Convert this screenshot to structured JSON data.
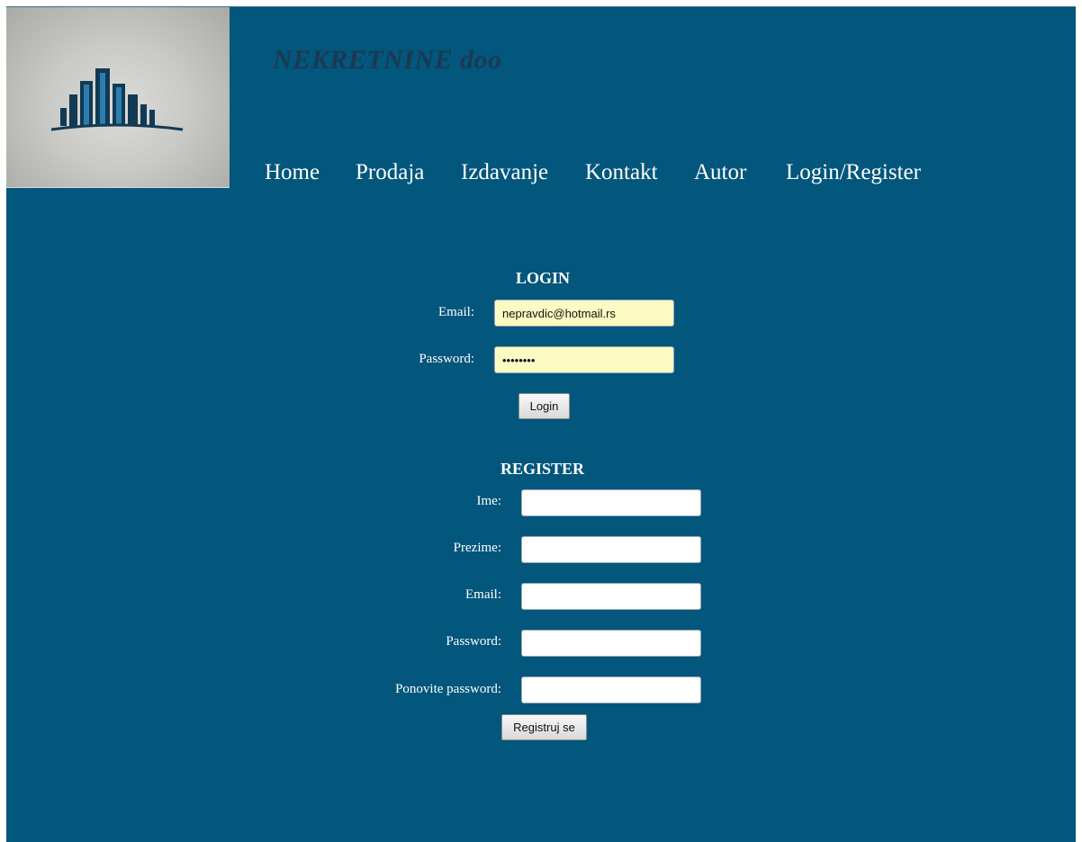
{
  "brand": {
    "name": "NEKRETNINE doo"
  },
  "nav": {
    "items": [
      {
        "label": "Home"
      },
      {
        "label": "Prodaja"
      },
      {
        "label": "Izdavanje"
      },
      {
        "label": "Kontakt"
      },
      {
        "label": "Autor"
      },
      {
        "label": "Login/Register"
      }
    ]
  },
  "login": {
    "title": "LOGIN",
    "email_label": "Email:",
    "email_value": "nepravdic@hotmail.rs",
    "password_label": "Password:",
    "password_value": "passwor1",
    "submit_label": "Login"
  },
  "register": {
    "title": "REGISTER",
    "ime_label": "Ime:",
    "prezime_label": "Prezime:",
    "email_label": "Email:",
    "password_label": "Password:",
    "repeat_password_label": "Ponovite password:",
    "submit_label": "Registruj se"
  },
  "colors": {
    "background": "#03567c",
    "field_autofill": "#fbfbc3",
    "brand_text": "#1a3a52"
  },
  "icons": {
    "logo": "buildings-logo-icon"
  }
}
